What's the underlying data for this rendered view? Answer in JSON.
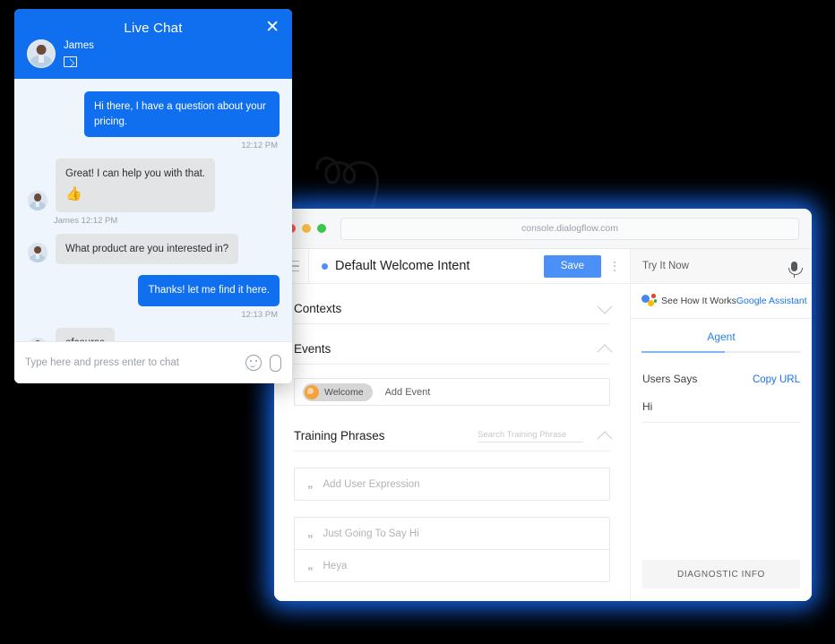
{
  "chat_widget": {
    "title": "Live Chat",
    "close_icon": "close-icon",
    "agent_name": "James",
    "mail_icon": "envelope-icon",
    "messages": [
      {
        "direction": "out",
        "text": "Hi there, I have a question about your pricing.",
        "stamp": "12:12 PM"
      },
      {
        "direction": "in",
        "text": "Great! I can help you with that.",
        "emoji": "👍",
        "stamp": "James 12:12 PM"
      },
      {
        "direction": "in",
        "text": "What product are you interested in?"
      },
      {
        "direction": "out",
        "text": "Thanks! let me find it here.",
        "stamp": "12:13 PM"
      },
      {
        "direction": "in",
        "text": "ofcourse"
      }
    ],
    "input_placeholder": "Type here and press enter to chat",
    "emoji_icon": "smiley-icon",
    "attach_icon": "paperclip-icon"
  },
  "browser": {
    "url": "console.dialogflow.com",
    "traffic_lights": [
      "close-red",
      "minimize-yellow",
      "zoom-green"
    ]
  },
  "app": {
    "menu_icon": "hamburger-icon",
    "intent_title": "Default Welcome Intent",
    "intent_status_dot": "status-dot-blue",
    "save_label": "Save",
    "more_icon": "kebab-menu-icon",
    "sections": {
      "contexts": {
        "title": "Contexts",
        "collapse_icon": "chevron-down-icon"
      },
      "events": {
        "title": "Events",
        "collapse_icon": "chevron-up-icon",
        "chip_label": "Welcome",
        "add_label": "Add Event"
      },
      "training": {
        "title": "Training Phrases",
        "search_placeholder": "Search Training Phrase",
        "collapse_icon": "chevron-up-icon",
        "add_expression_placeholder": "Add User Expression",
        "phrases": [
          "Just Going To Say Hi",
          "Heya"
        ]
      }
    }
  },
  "try_it": {
    "label": "Try It Now",
    "mic_icon": "microphone-icon",
    "assistant_icon": "google-assistant-icon",
    "see_how_it_works": "See How It Works",
    "google_assistant_link": "Google Assistant",
    "tab_label": "Agent",
    "users_says_label": "Users Says",
    "copy_url_label": "Copy URL",
    "users_says_value": "Hi",
    "diagnostic_label": "DIAGNOSTIC INFO"
  },
  "decor": {
    "arrow": "curly-arrow-icon"
  },
  "colors": {
    "chat_blue": "#0f6fef",
    "save_blue": "#4a90f7",
    "link_blue": "#1a73e8",
    "glow_blue": "#1769f0",
    "chip_orange": "#f6a23c"
  }
}
